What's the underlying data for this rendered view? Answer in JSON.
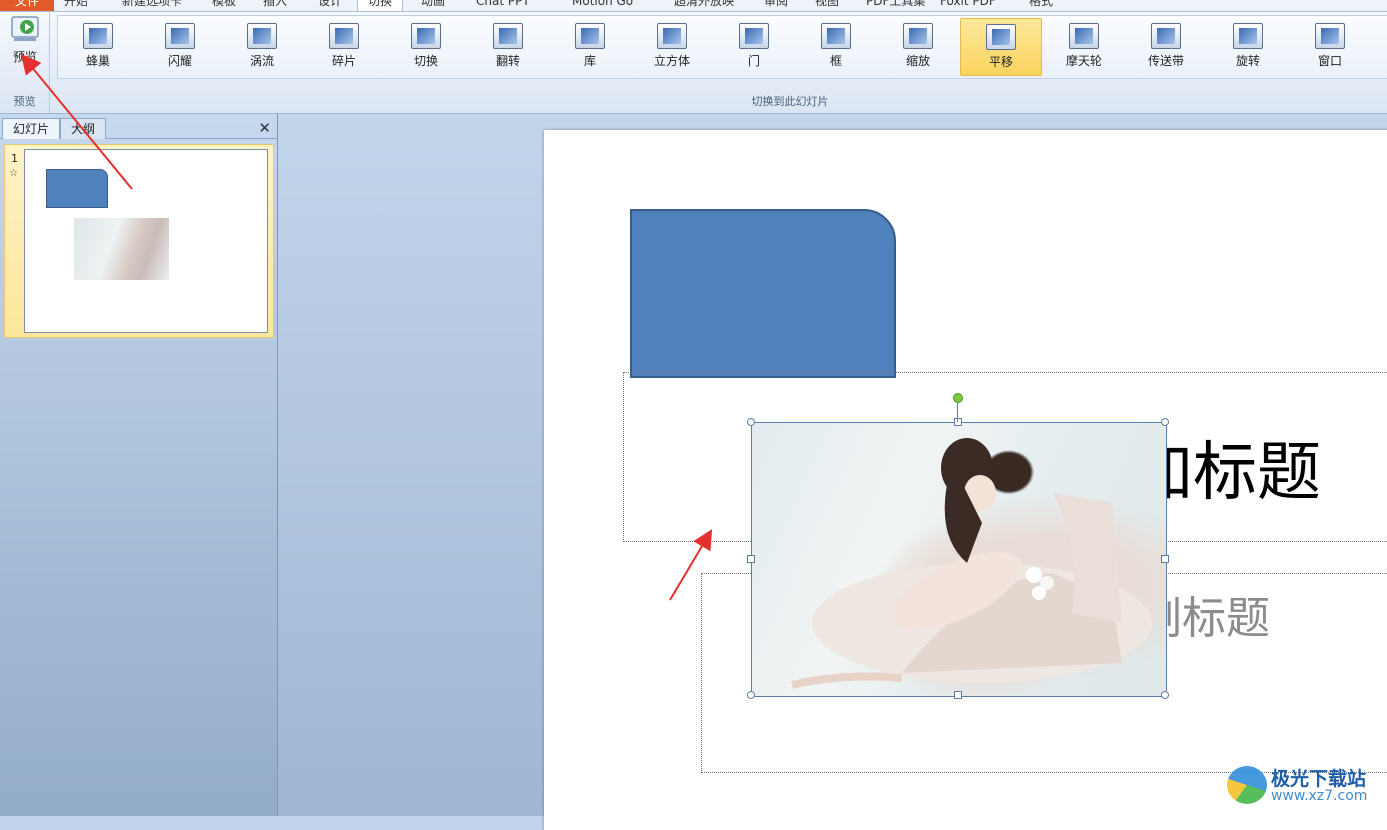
{
  "ribbon_tabs": {
    "file": "文件",
    "items": [
      "开始",
      "新建选项卡",
      "模板",
      "插入",
      "设计",
      "切换",
      "动画",
      "Chat PPT",
      "Motion Go",
      "超清外放映",
      "审阅",
      "视图",
      "PDF工具集",
      "Foxit PDF",
      "格式"
    ],
    "active": "切换"
  },
  "ribbon": {
    "preview_button": "预览",
    "preview_group": "预览",
    "transition_group": "切换到此幻灯片",
    "effects": [
      "蜂巢",
      "闪耀",
      "涡流",
      "碎片",
      "切换",
      "翻转",
      "库",
      "立方体",
      "门",
      "框",
      "缩放",
      "平移",
      "摩天轮",
      "传送带",
      "旋转",
      "窗口"
    ],
    "selected_effect": "平移"
  },
  "left_panel": {
    "tab_slides": "幻灯片",
    "tab_outline": "大纲",
    "close_glyph": "✕",
    "slide_number": "1",
    "slide_star": "☆"
  },
  "slide": {
    "title_placeholder": "单击此处添加标题",
    "subtitle_placeholder": "单击此处添加副标题",
    "shape_color": "#4F81BD"
  },
  "watermark": {
    "title": "极光下载站",
    "url": "www.xz7.com"
  },
  "annotation_color": "#E5312D"
}
